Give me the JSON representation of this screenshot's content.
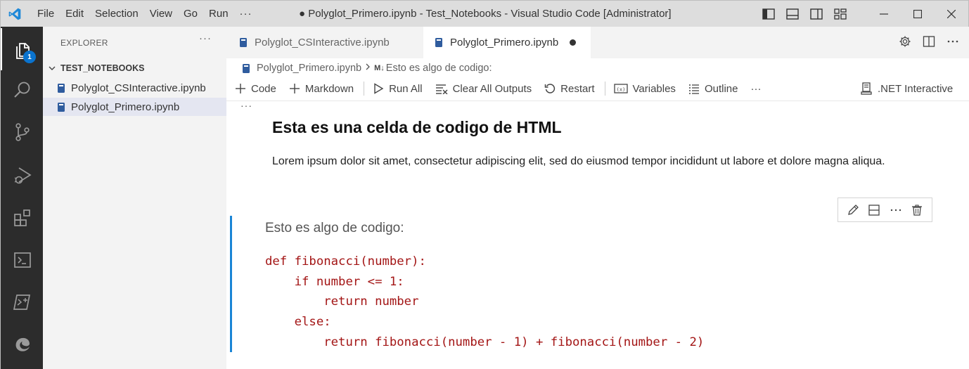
{
  "titlebar": {
    "menu": [
      "File",
      "Edit",
      "Selection",
      "View",
      "Go",
      "Run",
      "···"
    ],
    "window_title": "● Polyglot_Primero.ipynb - Test_Notebooks - Visual Studio Code [Administrator]"
  },
  "activity": {
    "explorer_badge": "1"
  },
  "sidebar": {
    "header": "EXPLORER",
    "more": "···",
    "folder": "TEST_NOTEBOOKS",
    "files": [
      "Polyglot_CSInteractive.ipynb",
      "Polyglot_Primero.ipynb"
    ]
  },
  "tabs": [
    {
      "label": "Polyglot_CSInteractive.ipynb"
    },
    {
      "label": "Polyglot_Primero.ipynb"
    }
  ],
  "breadcrumb": {
    "file": "Polyglot_Primero.ipynb",
    "md_tag": "M↓",
    "section": "Esto es algo de codigo:"
  },
  "toolbar": {
    "code": "Code",
    "markdown": "Markdown",
    "run_all": "Run All",
    "clear_all": "Clear All Outputs",
    "restart": "Restart",
    "variables": "Variables",
    "outline": "Outline",
    "more": "···",
    "kernel": ".NET Interactive"
  },
  "notebook": {
    "cell_dots": "···",
    "heading": "Esta es una celda de codigo de HTML",
    "paragraph": "Lorem ipsum dolor sit amet, consectetur adipiscing elit, sed do eiusmod tempor incididunt ut labore et dolore magna aliqua.",
    "code_label": "Esto es algo de codigo:",
    "code_lines": [
      "def fibonacci(number):",
      "    if number <= 1:",
      "        return number",
      "    else:",
      "        return fibonacci(number - 1) + fibonacci(number - 2)"
    ]
  },
  "colors": {
    "accent": "#1a85d6",
    "badge": "#0a73ce",
    "code_text": "#a31515",
    "activity_bar": "#2c2c2c"
  }
}
